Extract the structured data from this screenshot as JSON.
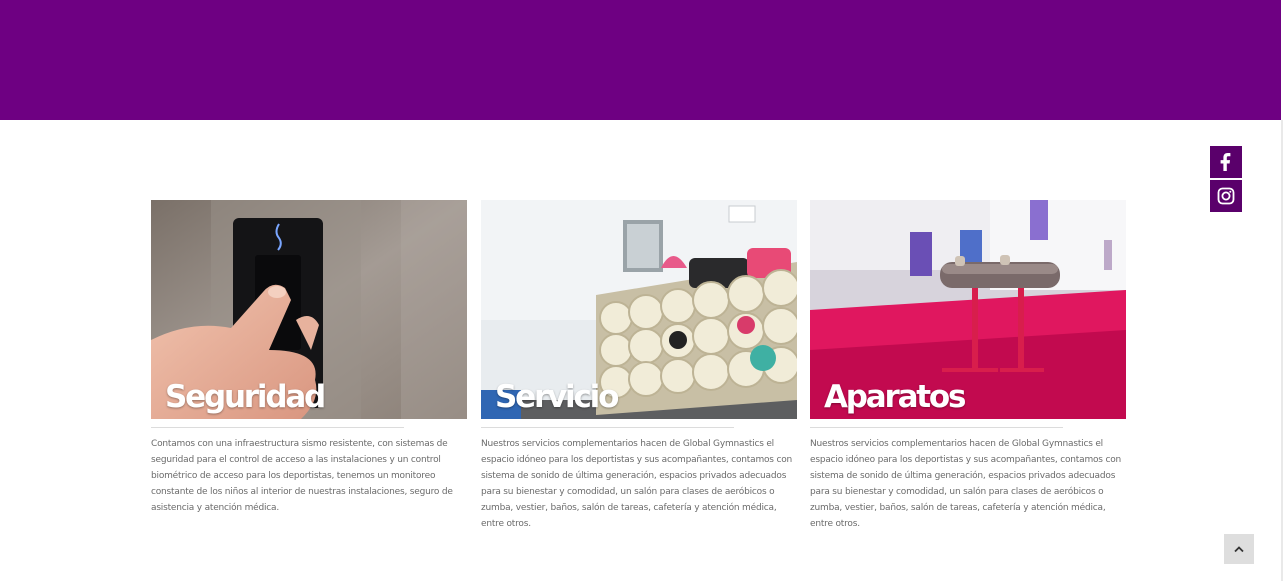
{
  "header": {
    "background_color": "#6e0082"
  },
  "social": [
    {
      "network": "facebook",
      "icon": "facebook-icon"
    },
    {
      "network": "instagram",
      "icon": "instagram-icon"
    }
  ],
  "cards": [
    {
      "title": "Seguridad",
      "image_subject": "finger on biometric scanner",
      "text": "Contamos con una infraestructura sismo resistente, con sistemas de seguridad para el control de acceso a las instalaciones y un control biométrico de acceso para los deportistas, tenemos un monitoreo constante de los niños al interior de nuestras instalaciones, seguro de asistencia y atención médica."
    },
    {
      "title": "Servicio",
      "image_subject": "cubby shelves with bags",
      "text": "Nuestros servicios complementarios hacen de Global Gymnastics el espacio idóneo para los deportistas y sus acompañantes, contamos con sistema de sonido de última generación, espacios privados adecuados para su bienestar y comodidad, un salón para clases de aeróbicos o zumba, vestier, baños, salón de tareas, cafetería y atención médica, entre otros."
    },
    {
      "title": "Aparatos",
      "image_subject": "pommel horse on red floor",
      "text": "Nuestros servicios complementarios hacen de Global Gymnastics el espacio idóneo para los deportistas y sus acompañantes, contamos con sistema de sonido de última generación, espacios privados adecuados para su bienestar y comodidad, un salón para clases de aeróbicos o zumba, vestier, baños, salón de tareas, cafetería y atención médica, entre otros."
    }
  ],
  "scroll_top": {
    "icon": "chevron-up-icon"
  }
}
